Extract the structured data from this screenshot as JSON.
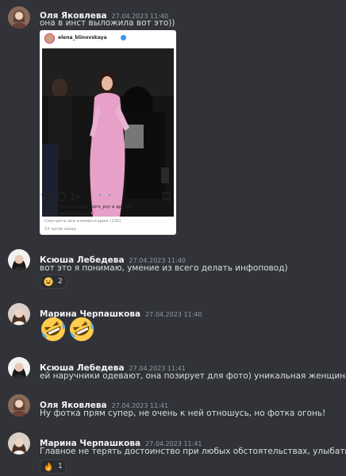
{
  "colors": {
    "background": "#313338",
    "author": "#f2f3f5",
    "timestamp": "#949ba4",
    "text": "#dbdee1",
    "reaction_bg": "#2b2d31",
    "ig_like_heart": "#e1306c"
  },
  "messages": [
    {
      "author": "Оля Яковлева",
      "timestamp": "27.04.2023 11:40",
      "text": "она в инст выложила вот это))",
      "embed": {
        "username": "elena_blinovskaya",
        "likes_text": "Нравится anastasia_ppro_psy и другим",
        "caption_user": "elena_blinovskaya",
        "caption_emoji": "pink-heart-icon",
        "comments_link": "Смотреть все комментарии (230)",
        "time_ago": "14 часов назад"
      }
    },
    {
      "author": "Ксюша Лебедева",
      "timestamp": "27.04.2023 11:40",
      "text": "вот это я понимаю, умение из всего делать инфоповод)",
      "reaction": {
        "emoji": "grinning-sweat-icon",
        "count": "2"
      }
    },
    {
      "author": "Марина Черпашкова",
      "timestamp": "27.04.2023 11:40",
      "emoji_only": [
        "rofl-icon",
        "rofl-icon"
      ]
    },
    {
      "author": "Ксюша Лебедева",
      "timestamp": "27.04.2023 11:41",
      "text": "ей наручники одевают, она позирует для фото) уникальная женщина)"
    },
    {
      "author": "Оля Яковлева",
      "timestamp": "27.04.2023 11:41",
      "text": "Ну фотка прям супер, не очень к ней отношусь, но фотка огонь!"
    },
    {
      "author": "Марина Черпашкова",
      "timestamp": "27.04.2023 11:41",
      "text": "Главное не терять достоинство при любых обстоятельствах, улыбаться)",
      "reaction": {
        "emoji": "fire-icon",
        "count": "1"
      }
    }
  ]
}
